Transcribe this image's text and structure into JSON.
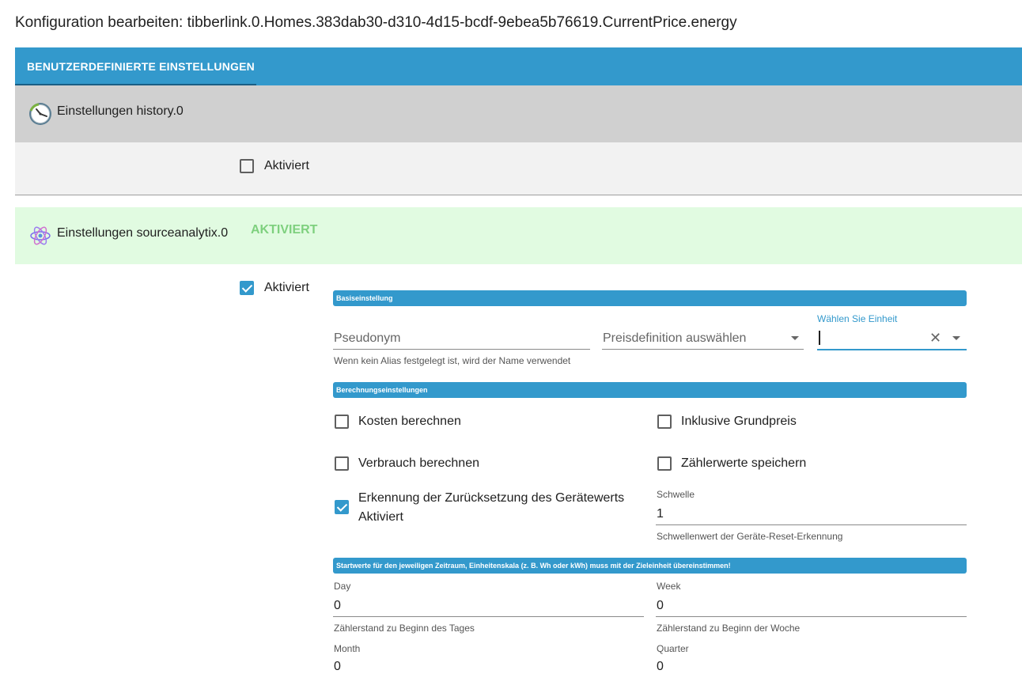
{
  "title": "Konfiguration bearbeiten: tibberlink.0.Homes.383dab30-d310-4d15-bcdf-9ebea5b76619.CurrentPrice.energy",
  "tabs": [
    {
      "label": "BENUTZERDEFINIERTE EINSTELLUNGEN",
      "active": true
    }
  ],
  "history": {
    "title": "Einstellungen history.0",
    "icon": "clock-icon",
    "enabled_label": "Aktiviert",
    "enabled": false
  },
  "sourceanalytix": {
    "title": "Einstellungen sourceanalytix.0",
    "status": "AKTIVIERT",
    "icon": "atom-icon",
    "enabled_label": "Aktiviert",
    "enabled": true,
    "sections": {
      "basic": "Basiseinstellung",
      "calc": "Berechnungseinstellungen",
      "start": "Startwerte für den jeweiligen Zeitraum, Einheitenskala (z. B. Wh oder kWh) muss mit der Zieleinheit übereinstimmen!"
    },
    "pseudonym": {
      "placeholder": "Pseudonym",
      "helper": "Wenn kein Alias festgelegt ist, wird der Name verwendet",
      "value": ""
    },
    "price_def": {
      "placeholder": "Preisdefinition auswählen",
      "value": ""
    },
    "unit": {
      "label": "Wählen Sie Einheit",
      "value": ""
    },
    "checkboxes": {
      "costs": {
        "label": "Kosten berechnen",
        "checked": false
      },
      "base_price": {
        "label": "Inklusive Grundpreis",
        "checked": false
      },
      "consumption": {
        "label": "Verbrauch berechnen",
        "checked": false
      },
      "meter_values": {
        "label": "Zählerwerte speichern",
        "checked": false
      },
      "reset_detect": {
        "label_line1": "Erkennung der Zurücksetzung des Gerätewerts",
        "label_line2": "Aktiviert",
        "checked": true
      }
    },
    "threshold": {
      "label": "Schwelle",
      "value": "1",
      "helper": "Schwellenwert der Geräte-Reset-Erkennung"
    },
    "start_values": {
      "day": {
        "label": "Day",
        "value": "0",
        "helper": "Zählerstand zu Beginn des Tages"
      },
      "week": {
        "label": "Week",
        "value": "0",
        "helper": "Zählerstand zu Beginn der Woche"
      },
      "month": {
        "label": "Month",
        "value": "0"
      },
      "quarter": {
        "label": "Quarter",
        "value": "0"
      }
    }
  },
  "colors": {
    "primary": "#3399cc",
    "history_header_bg": "#d0d0d0",
    "history_body_bg": "#f2f2f2",
    "sa_header_bg": "#e1fbe1",
    "active_status": "#7ed07e"
  }
}
